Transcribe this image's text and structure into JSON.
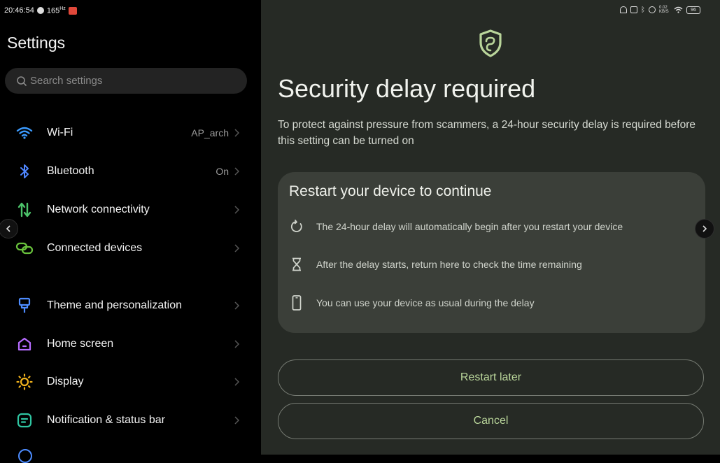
{
  "status_bar": {
    "time": "20:46:54",
    "refresh_rate": "165",
    "refresh_unit": "Hz",
    "network_speed": "0.02 KB/S",
    "battery": "96"
  },
  "settings": {
    "title": "Settings",
    "search_placeholder": "Search settings",
    "items": [
      {
        "label": "Wi-Fi",
        "value": "AP_arch",
        "icon": "wifi-icon",
        "color": "#3b9bff"
      },
      {
        "label": "Bluetooth",
        "value": "On",
        "icon": "bluetooth-icon",
        "color": "#4f86ff"
      },
      {
        "label": "Network connectivity",
        "value": "",
        "icon": "network-arrows-icon",
        "color": "#4cc36a"
      },
      {
        "label": "Connected devices",
        "value": "",
        "icon": "link-icon",
        "color": "#69c23c"
      },
      {
        "label": "Theme and personalization",
        "value": "",
        "icon": "brush-icon",
        "color": "#4d8cff"
      },
      {
        "label": "Home screen",
        "value": "",
        "icon": "home-icon",
        "color": "#b76cff"
      },
      {
        "label": "Display",
        "value": "",
        "icon": "sun-icon",
        "color": "#f2b31c"
      },
      {
        "label": "Notification & status bar",
        "value": "",
        "icon": "notification-icon",
        "color": "#2fc6a2"
      }
    ]
  },
  "dialog": {
    "title": "Security delay required",
    "description": "To protect against pressure from scammers, a 24-hour security delay is required before this setting can be turned on",
    "card_title": "Restart your device to continue",
    "steps": [
      {
        "text": "The 24-hour delay will automatically begin after you restart your device",
        "icon": "restart-icon"
      },
      {
        "text": "After the delay starts, return here to check the time remaining",
        "icon": "hourglass-icon"
      },
      {
        "text": "You can use your device as usual during the delay",
        "icon": "phone-icon"
      }
    ],
    "primary_button": "Restart later",
    "secondary_button": "Cancel",
    "accent_color": "#b9d59a"
  }
}
